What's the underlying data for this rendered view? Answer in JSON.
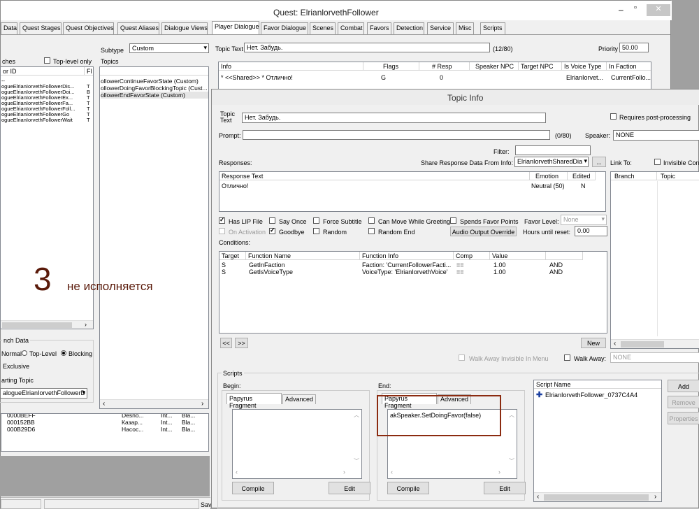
{
  "quest_window": {
    "title": "Quest: ElrianlorvethFollower",
    "tabs": [
      "Data",
      "Quest Stages",
      "Quest Objectives",
      "Quest Aliases",
      "Dialogue Views",
      "Player Dialogue",
      "Favor Dialogue",
      "Scenes",
      "Combat",
      "Favors",
      "Detection",
      "Service",
      "Misc",
      "Scripts"
    ],
    "branches_label": "ches",
    "toplevel_only_label": "Top-level only",
    "col_editor_id": "or ID",
    "col_fl": "Fl",
    "branch_rows": [
      {
        "id": "--",
        "fl": ""
      },
      {
        "id": "ogueElrianIorvethFollowerDis...",
        "fl": "T"
      },
      {
        "id": "ogueElrianIorvethFollowerDoi...",
        "fl": "B"
      },
      {
        "id": "ogueElrianIorvethFollowerEx...",
        "fl": "T"
      },
      {
        "id": "ogueElrianIorvethFollowerFa...",
        "fl": "T"
      },
      {
        "id": "ogueElrianIorvethFollowerFoll...",
        "fl": "T"
      },
      {
        "id": "ogueElrianIorvethFollowerGo",
        "fl": "T"
      },
      {
        "id": "ogueElrianIorvethFollowerWait",
        "fl": "T"
      }
    ],
    "subtype_label": "Subtype",
    "subtype_value": "Custom",
    "topics_label": "Topics",
    "topics": [
      "ollowerContinueFavorState (Custom)",
      "ollowerDoingFavorBlockingTopic (Cust...",
      "ollowerEndFavorState (Custom)"
    ],
    "topic_text_label": "Topic Text",
    "topic_text_value": "Нет. Забудь.",
    "topic_text_count": "(12/80)",
    "priority_label": "Priority",
    "priority_value": "50.00",
    "info_headers": [
      "Info",
      "Flags",
      "# Resp",
      "Speaker NPC",
      "Target NPC",
      "Is Voice Type",
      "In Faction"
    ],
    "info_row": [
      "* <<Shared>> * Отлично!",
      "G",
      "0",
      "",
      "",
      "ElrianIorvet...",
      "CurrentFollo..."
    ],
    "branch_data_label": "nch Data",
    "normal_label": "Normal",
    "toplevel_label": "Top-Level",
    "blocking_label": "Blocking",
    "exclusive_label": "Exclusive",
    "starting_topic_label": "arting Topic",
    "starting_topic_value": "alogueElrianIorvethFollowerD",
    "bottom_rows": [
      {
        "a": "0000BEFF",
        "b": "",
        "c": "Desno...",
        "d": "Int...",
        "e": "Bla..."
      },
      {
        "a": "000152BB",
        "b": "",
        "c": "Казар...",
        "d": "Int...",
        "e": "Bla..."
      },
      {
        "a": "000B29D6",
        "b": "",
        "c": "Насос...",
        "d": "Int...",
        "e": "Bla..."
      }
    ],
    "status_sav": "Sav"
  },
  "annotation": {
    "number": "3",
    "text": "не исполняется"
  },
  "topic_info": {
    "title": "Topic Info",
    "topic_text_label": "Topic Text",
    "topic_text_value": "Нет. Забудь.",
    "requires_post_label": "Requires post-processing",
    "prompt_label": "Prompt:",
    "prompt_count": "(0/80)",
    "speaker_label": "Speaker:",
    "speaker_value": "NONE",
    "filter_label": "Filter:",
    "responses_label": "Responses:",
    "share_label": "Share Response Data From Info:",
    "share_value": "ElrianIorvethSharedDia",
    "more_btn": "...",
    "link_to_label": "Link To:",
    "invisible_cont_label": "Invisible Cont",
    "link_headers": [
      "Branch",
      "Topic"
    ],
    "resp_headers": [
      "Response Text",
      "Emotion",
      "Edited"
    ],
    "resp_row": {
      "text": "Отлично!",
      "emotion": "Neutral (50)",
      "edited": "N"
    },
    "has_lip_label": "Has LIP File",
    "say_once_label": "Say Once",
    "force_subtitle_label": "Force Subtitle",
    "can_move_label": "Can Move While Greeting",
    "spends_favor_label": "Spends Favor Points",
    "favor_level_label": "Favor Level:",
    "favor_level_value": "None",
    "on_activation_label": "On Activation",
    "goodbye_label": "Goodbye",
    "random_label": "Random",
    "random_end_label": "Random End",
    "audio_override_btn": "Audio Output Override",
    "hours_label": "Hours until reset:",
    "hours_value": "0.00",
    "conditions_label": "Conditions:",
    "cond_headers": [
      "Target",
      "Function Name",
      "Function Info",
      "Comp",
      "Value",
      ""
    ],
    "conditions": [
      {
        "target": "S",
        "func": "GetInFaction",
        "info": "Faction: 'CurrentFollowerFacti...",
        "comp": "==",
        "value": "1.00",
        "op": "AND"
      },
      {
        "target": "S",
        "func": "GetIsVoiceType",
        "info": "VoiceType: 'ElrianIorvethVoice'",
        "comp": "==",
        "value": "1.00",
        "op": "AND"
      }
    ],
    "prev_btn": "<<",
    "next_btn": ">>",
    "new_btn": "New",
    "walk_invis_label": "Walk Away Invisible In Menu",
    "walk_away_label": "Walk Away:",
    "walk_away_value": "NONE",
    "scripts_label": "Scripts",
    "begin_label": "Begin:",
    "end_label": "End:",
    "papyrus_tab": "Papyrus Fragment",
    "advanced_tab": "Advanced",
    "end_code": "akSpeaker.SetDoingFavor(false)",
    "compile_btn": "Compile",
    "edit_btn": "Edit",
    "script_name_header": "Script Name",
    "script_name": "ElrianIorvethFollower_0737C4A4",
    "add_btn": "Add",
    "remove_btn": "Remove",
    "properties_btn": "Properties"
  },
  "colors": {
    "title_bar": "#ffffff",
    "annotation": "#5a1a0a",
    "highlight_box": "#8b2b10",
    "selection": "#3399ff"
  }
}
